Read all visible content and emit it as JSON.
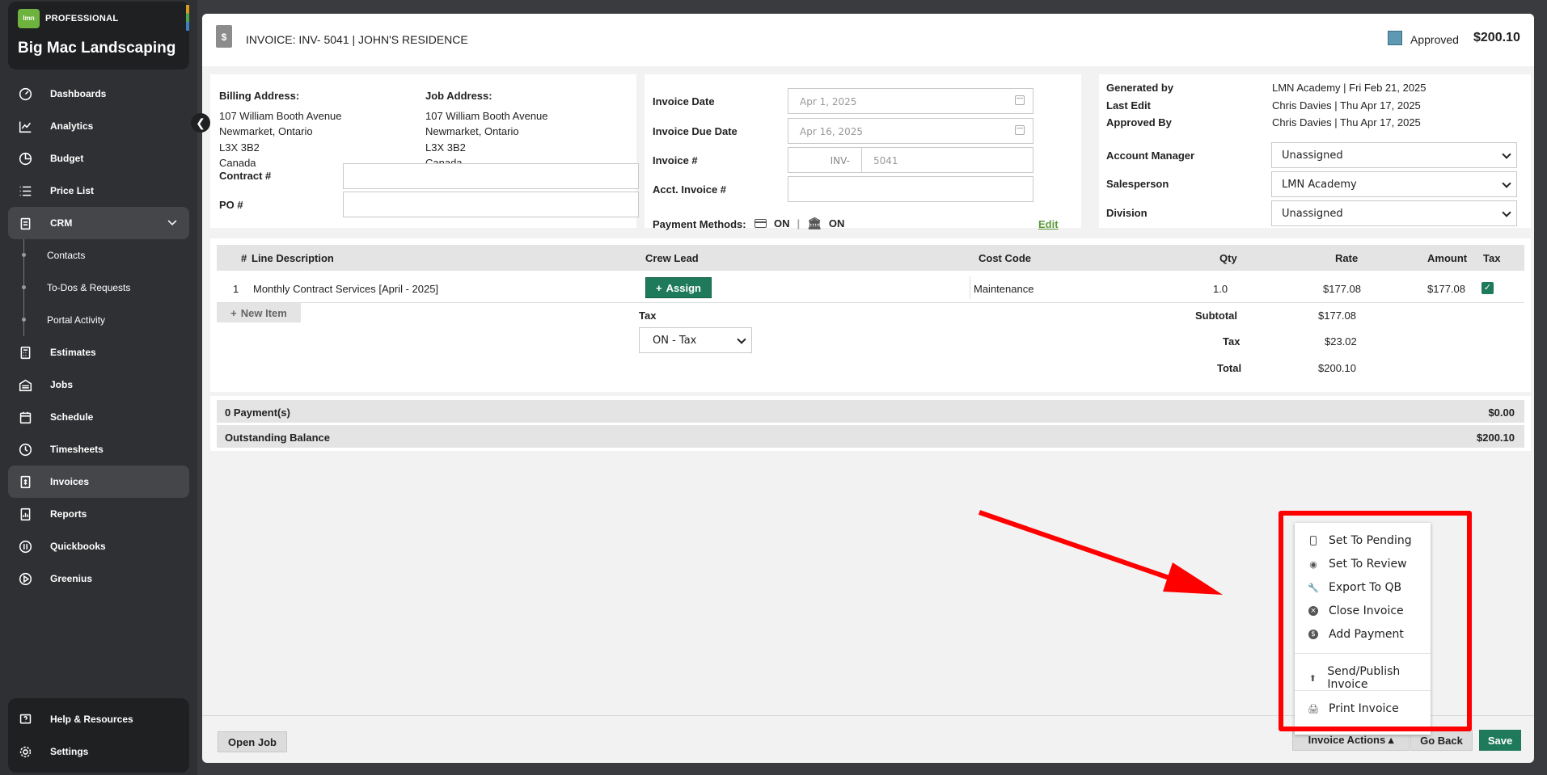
{
  "sidebar": {
    "logo_text": "lmn",
    "edition": "PROFESSIONAL",
    "company": "Big Mac Landscaping",
    "items": [
      {
        "label": "Dashboards",
        "icon": "gauge-icon"
      },
      {
        "label": "Analytics",
        "icon": "chart-line-icon"
      },
      {
        "label": "Budget",
        "icon": "pie-icon"
      },
      {
        "label": "Price List",
        "icon": "list-icon"
      },
      {
        "label": "CRM",
        "icon": "clipboard-icon"
      }
    ],
    "crm_sub": [
      {
        "label": "Contacts"
      },
      {
        "label": "To-Dos & Requests"
      },
      {
        "label": "Portal Activity"
      }
    ],
    "items2": [
      {
        "label": "Estimates",
        "icon": "calculator-icon"
      },
      {
        "label": "Jobs",
        "icon": "building-icon"
      },
      {
        "label": "Schedule",
        "icon": "calendar-icon"
      },
      {
        "label": "Timesheets",
        "icon": "clock-icon"
      },
      {
        "label": "Invoices",
        "icon": "invoice-icon"
      },
      {
        "label": "Reports",
        "icon": "report-icon"
      },
      {
        "label": "Quickbooks",
        "icon": "quickbooks-icon"
      },
      {
        "label": "Greenius",
        "icon": "play-icon"
      }
    ],
    "bottom": [
      {
        "label": "Help & Resources",
        "icon": "help-icon"
      },
      {
        "label": "Settings",
        "icon": "gear-icon"
      }
    ]
  },
  "header": {
    "title": "INVOICE: INV- 5041 | JOHN'S RESIDENCE",
    "status": "Approved",
    "amount": "$200.10",
    "status_color": "#5d99b3"
  },
  "address": {
    "billing_label": "Billing Address:",
    "billing_lines": [
      "107 William Booth Avenue",
      "Newmarket, Ontario",
      "L3X 3B2",
      "Canada"
    ],
    "job_label": "Job Address:",
    "job_lines": [
      "107 William Booth Avenue",
      "Newmarket, Ontario",
      "L3X 3B2",
      "Canada"
    ],
    "contract_label": "Contract #",
    "contract_value": "",
    "po_label": "PO #",
    "po_value": ""
  },
  "dates": {
    "invoice_date_label": "Invoice Date",
    "invoice_date": "Apr 1, 2025",
    "due_date_label": "Invoice Due Date",
    "due_date": "Apr 16, 2025",
    "invoice_no_label": "Invoice #",
    "invoice_prefix": "INV-",
    "invoice_no": "5041",
    "acct_label": "Acct. Invoice #",
    "acct_value": "",
    "payment_label": "Payment Methods:",
    "card_status": "ON",
    "bank_status": "ON",
    "edit_label": "Edit"
  },
  "meta": {
    "generated_label": "Generated by",
    "generated_value": "LMN Academy | Fri Feb 21, 2025",
    "last_edit_label": "Last Edit",
    "last_edit_value": "Chris Davies | Thu Apr 17, 2025",
    "approved_label": "Approved By",
    "approved_value": "Chris Davies | Thu Apr 17, 2025",
    "account_manager_label": "Account Manager",
    "account_manager": "Unassigned",
    "salesperson_label": "Salesperson",
    "salesperson": "LMN Academy",
    "division_label": "Division",
    "division": "Unassigned"
  },
  "table": {
    "headers": {
      "num": "#",
      "desc": "Line Description",
      "crew": "Crew Lead",
      "cost": "Cost Code",
      "qty": "Qty",
      "rate": "Rate",
      "amount": "Amount",
      "tax": "Tax"
    },
    "rows": [
      {
        "num": "1",
        "desc": "Monthly Contract Services [April - 2025]",
        "crew_button": "Assign",
        "cost": "Maintenance",
        "qty": "1.0",
        "rate": "$177.08",
        "amount": "$177.08"
      }
    ],
    "new_item": "New Item",
    "tax_label": "Tax",
    "tax_select": "ON - Tax",
    "subtotal_label": "Subtotal",
    "subtotal": "$177.08",
    "tax_total_label": "Tax",
    "tax_total": "$23.02",
    "total_label": "Total",
    "total": "$200.10"
  },
  "payments": {
    "count_label": "0 Payment(s)",
    "count_value": "$0.00",
    "balance_label": "Outstanding Balance",
    "balance_value": "$200.10"
  },
  "menu": {
    "items": [
      {
        "label": "Set To Pending",
        "icon": "phone-icon"
      },
      {
        "label": "Set To Review",
        "icon": "eye-icon"
      },
      {
        "label": "Export To QB",
        "icon": "wrench-icon"
      },
      {
        "label": "Close Invoice",
        "icon": "close-circle-icon"
      },
      {
        "label": "Add Payment",
        "icon": "dollar-circle-icon"
      },
      {
        "label": "Send/Publish Invoice",
        "icon": "upload-icon"
      },
      {
        "label": "Print Invoice",
        "icon": "printer-icon"
      }
    ]
  },
  "footer": {
    "open_job": "Open Job",
    "invoice_actions": "Invoice Actions ▴",
    "go_back": "Go Back",
    "save": "Save"
  },
  "colors": {
    "accent_green": "#1e7a5b",
    "highlight_red": "#ff0000",
    "sidebar_bg": "#2f3033"
  }
}
